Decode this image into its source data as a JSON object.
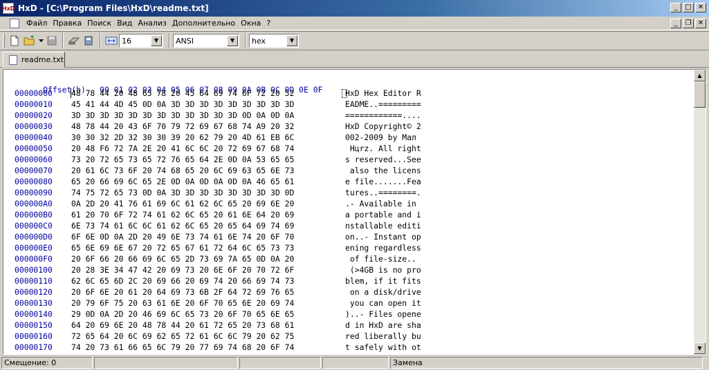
{
  "window": {
    "title": "HxD - [C:\\Program Files\\HxD\\readme.txt]",
    "app_icon_text": "HxD"
  },
  "menu": [
    "Файл",
    "Правка",
    "Поиск",
    "Вид",
    "Анализ",
    "Дополнительно",
    "Окна",
    "?"
  ],
  "toolbar": {
    "bytes_per_row": "16",
    "charset": "ANSI",
    "offset_base": "hex"
  },
  "tab": {
    "label": "readme.txt"
  },
  "editor": {
    "header_offset": "Offset(h)",
    "header_columns": "00 01 02 03 04 05 06 07 08 09 0A 0B 0C 0D 0E 0F",
    "rows": [
      {
        "offset": "00000000",
        "hex": "48 78 44 20 48 65 78 20 45 64 69 74 6F 72 20 52",
        "text": "HxD Hex Editor R"
      },
      {
        "offset": "00000010",
        "hex": "45 41 44 4D 45 0D 0A 3D 3D 3D 3D 3D 3D 3D 3D 3D",
        "text": "EADME..========="
      },
      {
        "offset": "00000020",
        "hex": "3D 3D 3D 3D 3D 3D 3D 3D 3D 3D 3D 3D 0D 0A 0D 0A",
        "text": "============...."
      },
      {
        "offset": "00000030",
        "hex": "48 78 44 20 43 6F 70 79 72 69 67 68 74 A9 20 32",
        "text": "HxD Copyright© 2"
      },
      {
        "offset": "00000040",
        "hex": "30 30 32 2D 32 30 30 39 20 62 79 20 4D 61 EB 6C",
        "text": "002-2009 by Мал"
      },
      {
        "offset": "00000050",
        "hex": "20 48 F6 72 7A 2E 20 41 6C 6C 20 72 69 67 68 74",
        "text": " Hцrz. All right"
      },
      {
        "offset": "00000060",
        "hex": "73 20 72 65 73 65 72 76 65 64 2E 0D 0A 53 65 65",
        "text": "s reserved...See"
      },
      {
        "offset": "00000070",
        "hex": "20 61 6C 73 6F 20 74 68 65 20 6C 69 63 65 6E 73",
        "text": " also the licens"
      },
      {
        "offset": "00000080",
        "hex": "65 20 66 69 6C 65 2E 0D 0A 0D 0A 0D 0A 46 65 61",
        "text": "e file.......Fea"
      },
      {
        "offset": "00000090",
        "hex": "74 75 72 65 73 0D 0A 3D 3D 3D 3D 3D 3D 3D 3D 0D",
        "text": "tures..========."
      },
      {
        "offset": "000000A0",
        "hex": "0A 2D 20 41 76 61 69 6C 61 62 6C 65 20 69 6E 20",
        "text": ".- Available in "
      },
      {
        "offset": "000000B0",
        "hex": "61 20 70 6F 72 74 61 62 6C 65 20 61 6E 64 20 69",
        "text": "a portable and i"
      },
      {
        "offset": "000000C0",
        "hex": "6E 73 74 61 6C 6C 61 62 6C 65 20 65 64 69 74 69",
        "text": "nstallable editi"
      },
      {
        "offset": "000000D0",
        "hex": "6F 6E 0D 0A 2D 20 49 6E 73 74 61 6E 74 20 6F 70",
        "text": "on..- Instant op"
      },
      {
        "offset": "000000E0",
        "hex": "65 6E 69 6E 67 20 72 65 67 61 72 64 6C 65 73 73",
        "text": "ening regardless"
      },
      {
        "offset": "000000F0",
        "hex": "20 6F 66 20 66 69 6C 65 2D 73 69 7A 65 0D 0A 20",
        "text": " of file-size.. "
      },
      {
        "offset": "00000100",
        "hex": "20 28 3E 34 47 42 20 69 73 20 6E 6F 20 70 72 6F",
        "text": " (>4GB is no pro"
      },
      {
        "offset": "00000110",
        "hex": "62 6C 65 6D 2C 20 69 66 20 69 74 20 66 69 74 73",
        "text": "blem, if it fits"
      },
      {
        "offset": "00000120",
        "hex": "20 6F 6E 20 61 20 64 69 73 6B 2F 64 72 69 76 65",
        "text": " on a disk/drive"
      },
      {
        "offset": "00000130",
        "hex": "20 79 6F 75 20 63 61 6E 20 6F 70 65 6E 20 69 74",
        "text": " you can open it"
      },
      {
        "offset": "00000140",
        "hex": "29 0D 0A 2D 20 46 69 6C 65 73 20 6F 70 65 6E 65",
        "text": ")..- Files opene"
      },
      {
        "offset": "00000150",
        "hex": "64 20 69 6E 20 48 78 44 20 61 72 65 20 73 68 61",
        "text": "d in HxD are sha"
      },
      {
        "offset": "00000160",
        "hex": "72 65 64 20 6C 69 62 65 72 61 6C 6C 79 20 62 75",
        "text": "red liberally bu"
      },
      {
        "offset": "00000170",
        "hex": "74 20 73 61 66 65 6C 79 20 77 69 74 68 20 6F 74",
        "text": "t safely with ot"
      }
    ]
  },
  "status": {
    "offset": "Смещение: 0",
    "mode": "Замена"
  }
}
